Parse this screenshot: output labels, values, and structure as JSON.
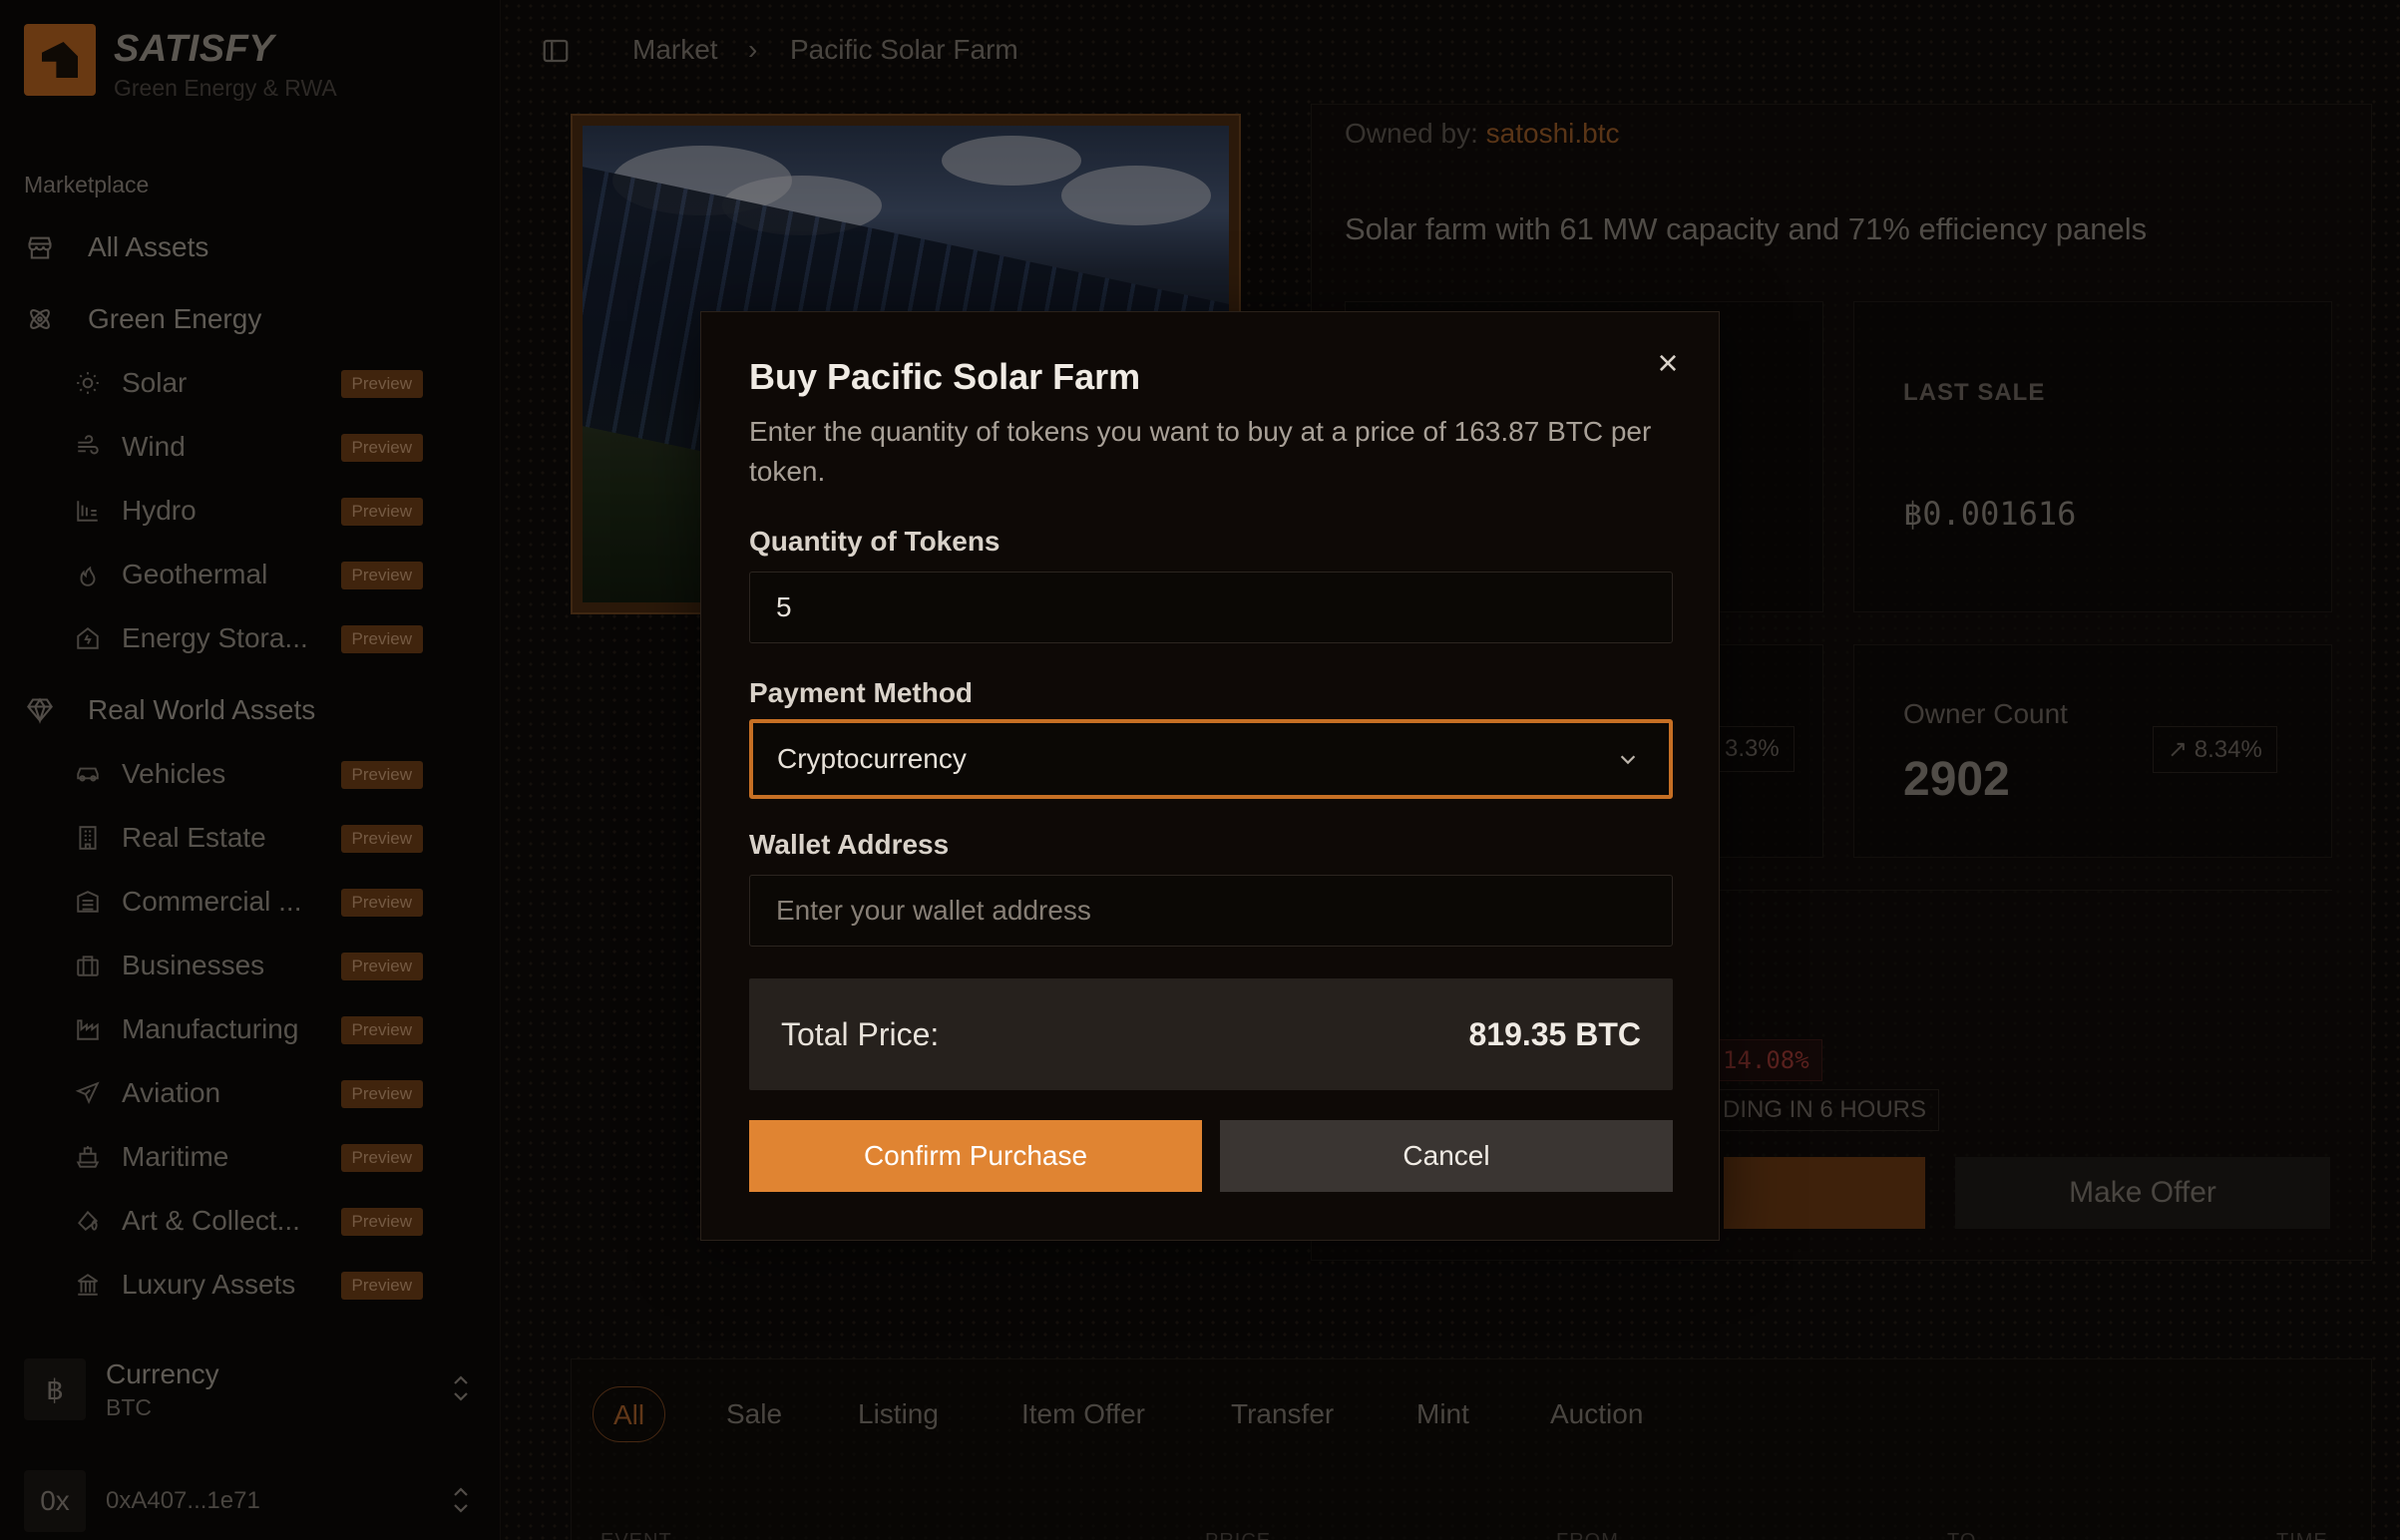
{
  "brand": {
    "name": "SATISFY",
    "subtitle": "Green Energy & RWA"
  },
  "sidebar": {
    "section_label": "Marketplace",
    "top_items": [
      {
        "label": "All Assets",
        "icon": "store-icon"
      },
      {
        "label": "Green Energy",
        "icon": "atom-icon"
      }
    ],
    "green_items": [
      {
        "label": "Solar",
        "icon": "sun-icon",
        "badge": "Preview"
      },
      {
        "label": "Wind",
        "icon": "wind-icon",
        "badge": "Preview"
      },
      {
        "label": "Hydro",
        "icon": "dam-icon",
        "badge": "Preview"
      },
      {
        "label": "Geothermal",
        "icon": "flame-icon",
        "badge": "Preview"
      },
      {
        "label": "Energy Stora...",
        "icon": "battery-house-icon",
        "badge": "Preview"
      }
    ],
    "rwa_label": "Real World Assets",
    "rwa_icon": "gem-icon",
    "rwa_items": [
      {
        "label": "Vehicles",
        "icon": "car-icon",
        "badge": "Preview"
      },
      {
        "label": "Real Estate",
        "icon": "building-icon",
        "badge": "Preview"
      },
      {
        "label": "Commercial ...",
        "icon": "office-icon",
        "badge": "Preview"
      },
      {
        "label": "Businesses",
        "icon": "briefcase-icon",
        "badge": "Preview"
      },
      {
        "label": "Manufacturing",
        "icon": "factory-icon",
        "badge": "Preview"
      },
      {
        "label": "Aviation",
        "icon": "plane-icon",
        "badge": "Preview"
      },
      {
        "label": "Maritime",
        "icon": "ship-icon",
        "badge": "Preview"
      },
      {
        "label": "Art & Collect...",
        "icon": "paint-icon",
        "badge": "Preview"
      },
      {
        "label": "Luxury Assets",
        "icon": "landmark-icon",
        "badge": "Preview"
      }
    ],
    "currency": {
      "label": "Currency",
      "value": "BTC",
      "symbol": "฿"
    },
    "wallet": {
      "prefix": "0x",
      "address": "0xA407...1e71"
    }
  },
  "breadcrumb": {
    "root": "Market",
    "separator": "›",
    "current": "Pacific Solar Farm"
  },
  "asset": {
    "owned_label": "Owned by:",
    "owner": "satoshi.btc",
    "description": "Solar farm with 61 MW capacity and 71% efficiency panels",
    "last_sale_label": "LAST SALE",
    "last_sale_value": "฿0.001616",
    "owner_count_label": "Owner Count",
    "owner_count_value": "2902",
    "owner_count_change": "8.34%",
    "left_change_partial": "3.3%",
    "price_change_partial": "14.08%",
    "ending_partial": "DING IN 6 HOURS",
    "make_offer": "Make Offer"
  },
  "activity": {
    "tabs": [
      "All",
      "Sale",
      "Listing",
      "Item Offer",
      "Transfer",
      "Mint",
      "Auction"
    ],
    "columns": [
      "EVENT",
      "PRICE",
      "FROM",
      "TO",
      "TIME"
    ]
  },
  "modal": {
    "title": "Buy Pacific Solar Farm",
    "description": "Enter the quantity of tokens you want to buy at a price of 163.87 BTC per token.",
    "quantity_label": "Quantity of Tokens",
    "quantity_value": "5",
    "payment_label": "Payment Method",
    "payment_value": "Cryptocurrency",
    "wallet_label": "Wallet Address",
    "wallet_placeholder": "Enter your wallet address",
    "total_label": "Total Price:",
    "total_value": "819.35 BTC",
    "confirm": "Confirm Purchase",
    "cancel": "Cancel",
    "close": "×"
  },
  "colors": {
    "accent": "#e08432",
    "badge_bg": "#6e3f18",
    "focus_ring": "#c66f24"
  }
}
